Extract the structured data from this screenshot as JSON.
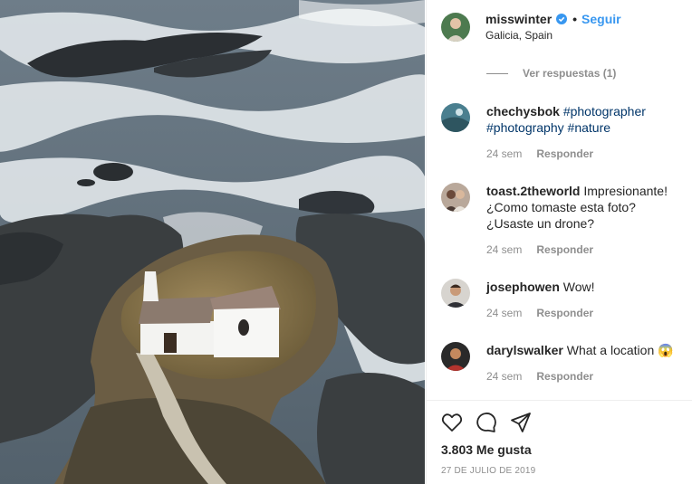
{
  "header": {
    "username": "misswinter",
    "separator": "•",
    "follow_label": "Seguir",
    "location": "Galicia, Spain"
  },
  "view_replies": "Ver respuestas (1)",
  "comments": [
    {
      "username": "chechysbok",
      "text_parts": [
        "#photographer",
        "#photography",
        "#nature"
      ],
      "time": "24 sem",
      "reply": "Responder"
    },
    {
      "username": "toast.2theworld",
      "text": "Impresionante! ¿Como tomaste esta foto? ¿Usaste un drone?",
      "time": "24 sem",
      "reply": "Responder"
    },
    {
      "username": "josephowen",
      "text": "Wow!",
      "time": "24 sem",
      "reply": "Responder"
    },
    {
      "username": "darylswalker",
      "text": "What a location",
      "emoji": "😱",
      "time": "24 sem",
      "reply": "Responder"
    }
  ],
  "likes": "3.803 Me gusta",
  "date": "27 DE JULIO DE 2019",
  "icons": [
    "verified-badge-icon",
    "heart-icon",
    "comment-icon",
    "share-icon"
  ],
  "colors": {
    "link": "#3897f0",
    "hashtag": "#003569",
    "muted": "#8e8e8e",
    "text": "#262626"
  }
}
